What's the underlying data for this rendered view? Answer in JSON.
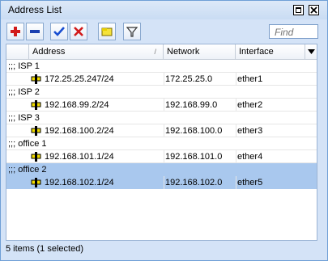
{
  "window": {
    "title": "Address List"
  },
  "toolbar": {
    "find_placeholder": "Find"
  },
  "table": {
    "columns": [
      "Address",
      "Network",
      "Interface"
    ],
    "groups": [
      {
        "comment": ";;; ISP 1",
        "address": "172.25.25.247/24",
        "network": "172.25.25.0",
        "interface": "ether1",
        "selected": false
      },
      {
        "comment": ";;; ISP 2",
        "address": "192.168.99.2/24",
        "network": "192.168.99.0",
        "interface": "ether2",
        "selected": false
      },
      {
        "comment": ";;; ISP 3",
        "address": "192.168.100.2/24",
        "network": "192.168.100.0",
        "interface": "ether3",
        "selected": false
      },
      {
        "comment": ";;; office 1",
        "address": "192.168.101.1/24",
        "network": "192.168.101.0",
        "interface": "ether4",
        "selected": false
      },
      {
        "comment": ";;; office 2",
        "address": "192.168.102.1/24",
        "network": "192.168.102.0",
        "interface": "ether5",
        "selected": true
      }
    ]
  },
  "status": {
    "text": "5 items (1 selected)"
  },
  "colors": {
    "accent": "#a9c8ee",
    "add": "#d11a1a",
    "enable": "#1a4fd1",
    "disable": "#d11a1a",
    "ip_icon": "#d6c200"
  }
}
